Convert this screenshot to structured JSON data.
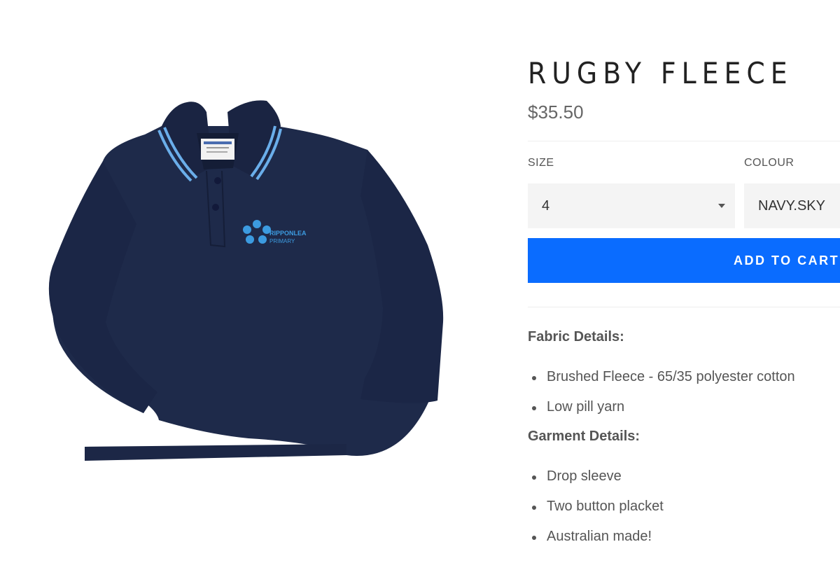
{
  "product": {
    "title": "RUGBY FLEECE",
    "price": "$35.50",
    "image": {
      "garment_color": "#1e2a4a",
      "collar_stripe_color": "#6aaeea",
      "logo_color": "#3c9be0",
      "logo_text_line1": "RIPPONLEA",
      "logo_text_line2": "PRIMARY"
    }
  },
  "options": {
    "size_label": "SIZE",
    "size_value": "4",
    "colour_label": "COLOUR",
    "colour_value": "NAVY.SKY"
  },
  "cart": {
    "button_label": "ADD TO CART",
    "button_color": "#0a6cff"
  },
  "description": {
    "fabric_heading": "Fabric Details:",
    "fabric_items": [
      "Brushed Fleece - 65/35 polyester cotton",
      "Low pill yarn"
    ],
    "garment_heading": "Garment Details:",
    "garment_items": [
      "Drop sleeve",
      "Two button placket",
      "Australian made!"
    ]
  }
}
